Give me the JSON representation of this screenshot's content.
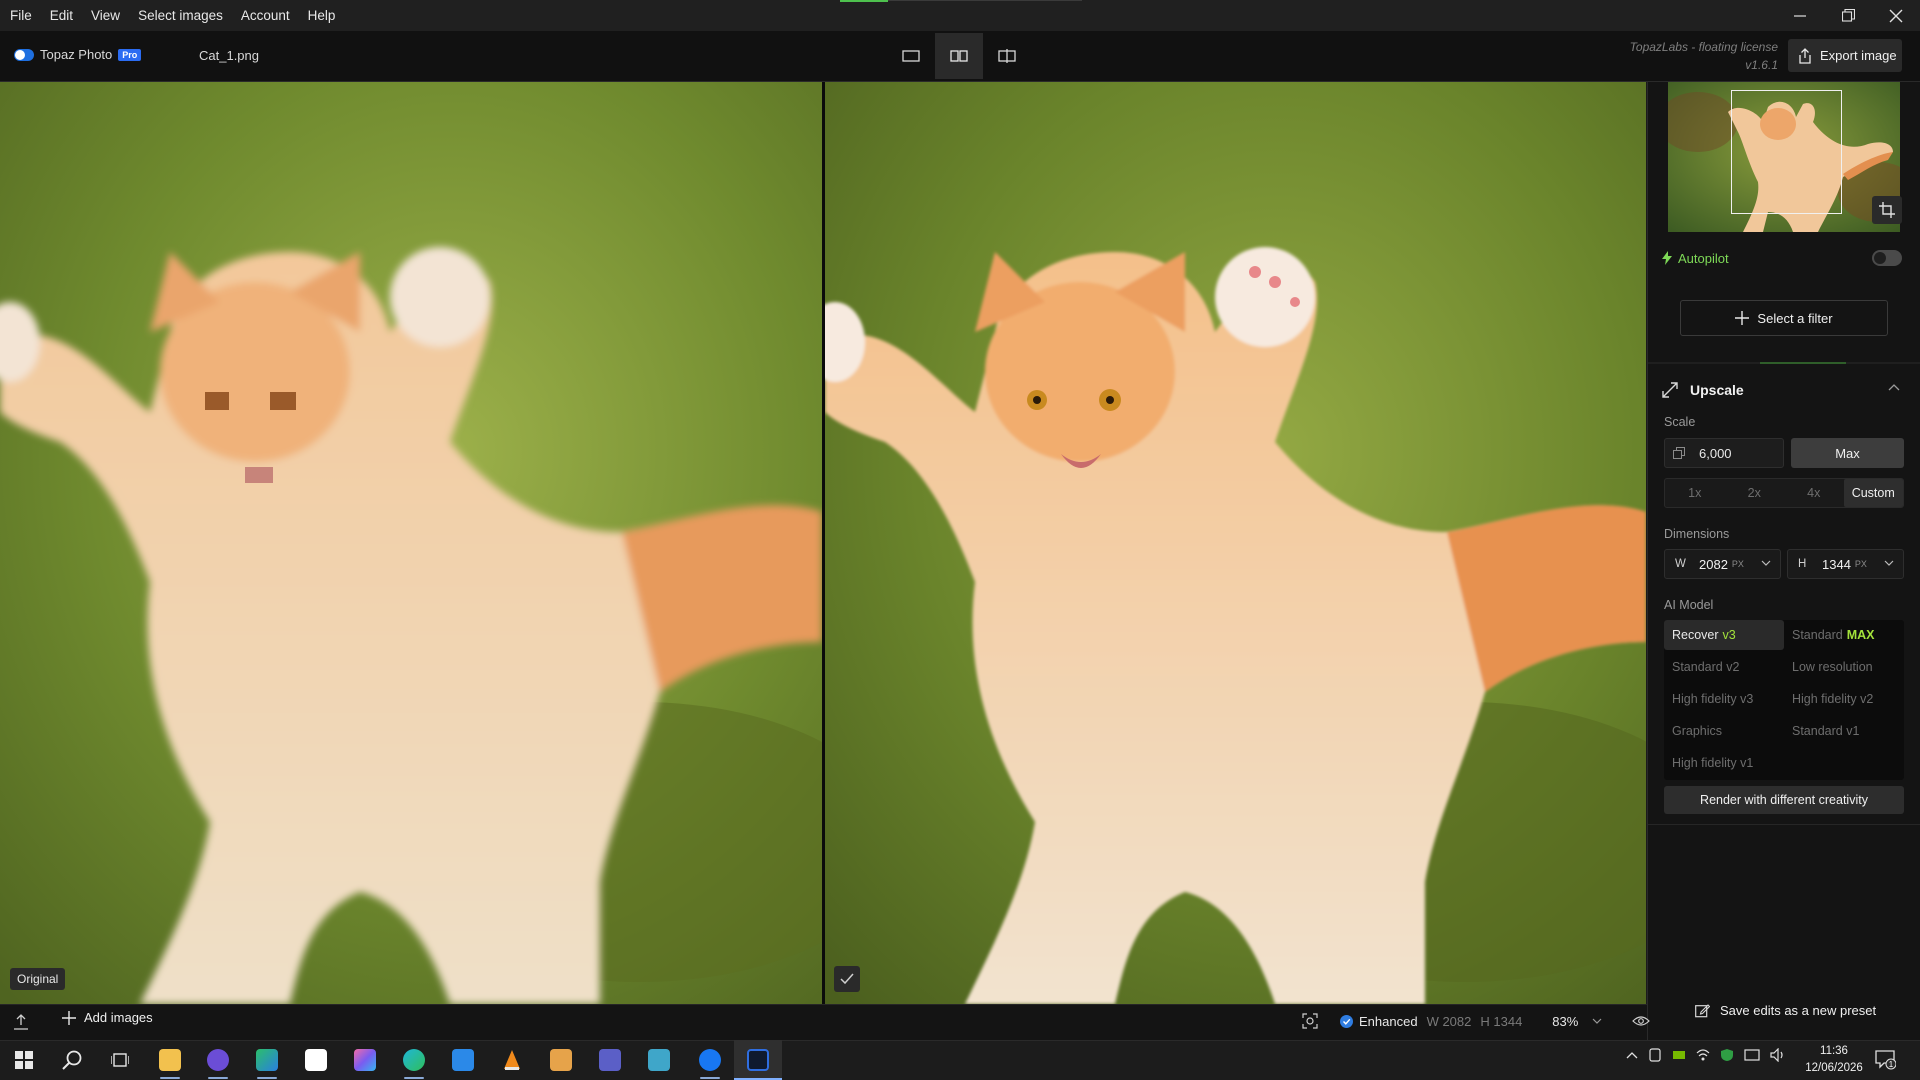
{
  "menubar": {
    "items": [
      "File",
      "Edit",
      "View",
      "Select images",
      "Account",
      "Help"
    ]
  },
  "toolbar": {
    "brand": "Topaz Photo",
    "badge": "Pro",
    "file_name": "Cat_1.png",
    "license_line1": "TopazLabs - floating license",
    "license_line2": "v1.6.1",
    "export_label": "Export image"
  },
  "viewer": {
    "original_label": "Original"
  },
  "panel": {
    "autopilot_label": "Autopilot",
    "select_filter_label": "Select a filter",
    "upscale_title": "Upscale",
    "scale_label": "Scale",
    "scale_value": "6,000",
    "max_label": "Max",
    "scale_options": [
      "1x",
      "2x",
      "4x",
      "Custom"
    ],
    "dimensions_label": "Dimensions",
    "width_key": "W",
    "width_value": "2082",
    "height_key": "H",
    "height_value": "1344",
    "unit": "PX",
    "model_label": "AI Model",
    "models": [
      {
        "name": "Recover",
        "tag": "v3"
      },
      {
        "name": "Standard",
        "tag": "MAX"
      },
      {
        "name": "Standard v2",
        "tag": ""
      },
      {
        "name": "Low resolution",
        "tag": ""
      },
      {
        "name": "High fidelity v3",
        "tag": ""
      },
      {
        "name": "High fidelity v2",
        "tag": ""
      },
      {
        "name": "Graphics",
        "tag": ""
      },
      {
        "name": "Standard v1",
        "tag": ""
      },
      {
        "name": "High fidelity v1",
        "tag": ""
      }
    ],
    "render_label": "Render with different creativity",
    "save_preset_label": "Save edits as a new preset"
  },
  "statusbar": {
    "add_images_label": "Add images",
    "enhanced_label": "Enhanced",
    "width_meta": "W 2082",
    "height_meta": "H 1344",
    "zoom": "83%"
  },
  "taskbar": {
    "time": "11:36",
    "date": "12/06/2026",
    "notification_count": "1"
  },
  "colors": {
    "accent_green": "#7ed957",
    "brand_blue": "#2b6cf2",
    "tag_lime": "#a4e33b"
  }
}
